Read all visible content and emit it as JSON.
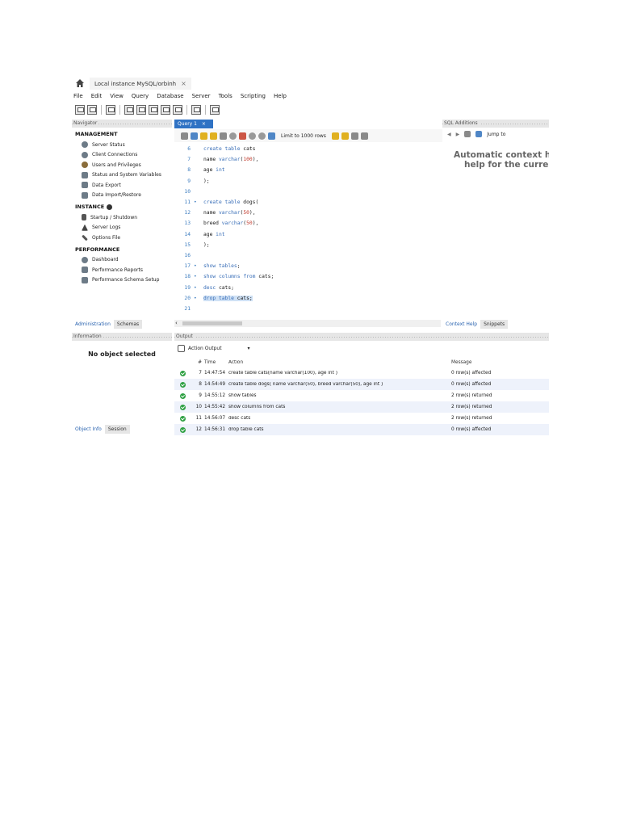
{
  "window": {
    "connection_tab": "Local instance MySQL/orbinh",
    "close_glyph": "×"
  },
  "menu": [
    "File",
    "Edit",
    "View",
    "Query",
    "Database",
    "Server",
    "Tools",
    "Scripting",
    "Help"
  ],
  "navigator": {
    "header": "Navigator",
    "management_title": "MANAGEMENT",
    "management": [
      {
        "label": "Server Status",
        "icon": "server-status-icon"
      },
      {
        "label": "Client Connections",
        "icon": "client-connections-icon"
      },
      {
        "label": "Users and Privileges",
        "icon": "users-icon"
      },
      {
        "label": "Status and System Variables",
        "icon": "variables-icon"
      },
      {
        "label": "Data Export",
        "icon": "data-export-icon"
      },
      {
        "label": "Data Import/Restore",
        "icon": "data-import-icon"
      }
    ],
    "instance_title": "INSTANCE",
    "instance": [
      {
        "label": "Startup / Shutdown",
        "icon": "startup-icon"
      },
      {
        "label": "Server Logs",
        "icon": "server-logs-icon"
      },
      {
        "label": "Options File",
        "icon": "options-file-icon"
      }
    ],
    "performance_title": "PERFORMANCE",
    "performance": [
      {
        "label": "Dashboard",
        "icon": "dashboard-icon"
      },
      {
        "label": "Performance Reports",
        "icon": "reports-icon"
      },
      {
        "label": "Performance Schema Setup",
        "icon": "schema-setup-icon"
      }
    ],
    "tabs": [
      "Administration",
      "Schemas"
    ]
  },
  "query": {
    "tab_label": "Query 1",
    "tab_close": "×",
    "limit_label": "Limit to 1000 rows",
    "lines": [
      {
        "n": "6",
        "marker": "",
        "code": "create table cats"
      },
      {
        "n": "7",
        "marker": "",
        "code": "name varchar(100),"
      },
      {
        "n": "8",
        "marker": "",
        "code": "age int"
      },
      {
        "n": "9",
        "marker": "",
        "code": ");"
      },
      {
        "n": "10",
        "marker": "",
        "code": ""
      },
      {
        "n": "11",
        "marker": "•",
        "code": "create table dogs("
      },
      {
        "n": "12",
        "marker": "",
        "code": "name varchar(50),"
      },
      {
        "n": "13",
        "marker": "",
        "code": "breed varchar(50),"
      },
      {
        "n": "14",
        "marker": "",
        "code": "age int"
      },
      {
        "n": "15",
        "marker": "",
        "code": ");"
      },
      {
        "n": "16",
        "marker": "",
        "code": ""
      },
      {
        "n": "17",
        "marker": "•",
        "code": "show tables;"
      },
      {
        "n": "18",
        "marker": "•",
        "code": "show columns from cats;"
      },
      {
        "n": "19",
        "marker": "•",
        "code": "desc cats;"
      },
      {
        "n": "20",
        "marker": "•",
        "code": "drop table cats;"
      },
      {
        "n": "21",
        "marker": "",
        "code": ""
      }
    ]
  },
  "sql_additions": {
    "header": "SQL Additions",
    "jump_to": "Jump to",
    "help_line1": "Automatic context help",
    "help_line2": "help for the current c",
    "tabs": [
      "Context Help",
      "Snippets"
    ]
  },
  "information": {
    "header": "Information",
    "no_object": "No object selected",
    "tabs": [
      "Object Info",
      "Session"
    ]
  },
  "output": {
    "header": "Output",
    "selector": "Action Output",
    "columns": {
      "num": "#",
      "time": "Time",
      "action": "Action",
      "message": "Message"
    },
    "rows": [
      {
        "num": "7",
        "time": "14:47:54",
        "action": "create table cats(name varchar(100), age int )",
        "message": "0 row(s) affected"
      },
      {
        "num": "8",
        "time": "14:54:49",
        "action": "create table dogs( name varchar(50), breed varchar(50), age int )",
        "message": "0 row(s) affected"
      },
      {
        "num": "9",
        "time": "14:55:12",
        "action": "show tables",
        "message": "2 row(s) returned"
      },
      {
        "num": "10",
        "time": "14:55:42",
        "action": "show columns from cats",
        "message": "2 row(s) returned"
      },
      {
        "num": "11",
        "time": "14:56:07",
        "action": "desc cats",
        "message": "2 row(s) returned"
      },
      {
        "num": "12",
        "time": "14:56:31",
        "action": "drop table cats",
        "message": "0 row(s) affected"
      }
    ]
  },
  "colors": {
    "accent": "#2f72c4",
    "ok": "#2ea043",
    "keyword": "#3a6fb8",
    "number": "#c0392b"
  }
}
